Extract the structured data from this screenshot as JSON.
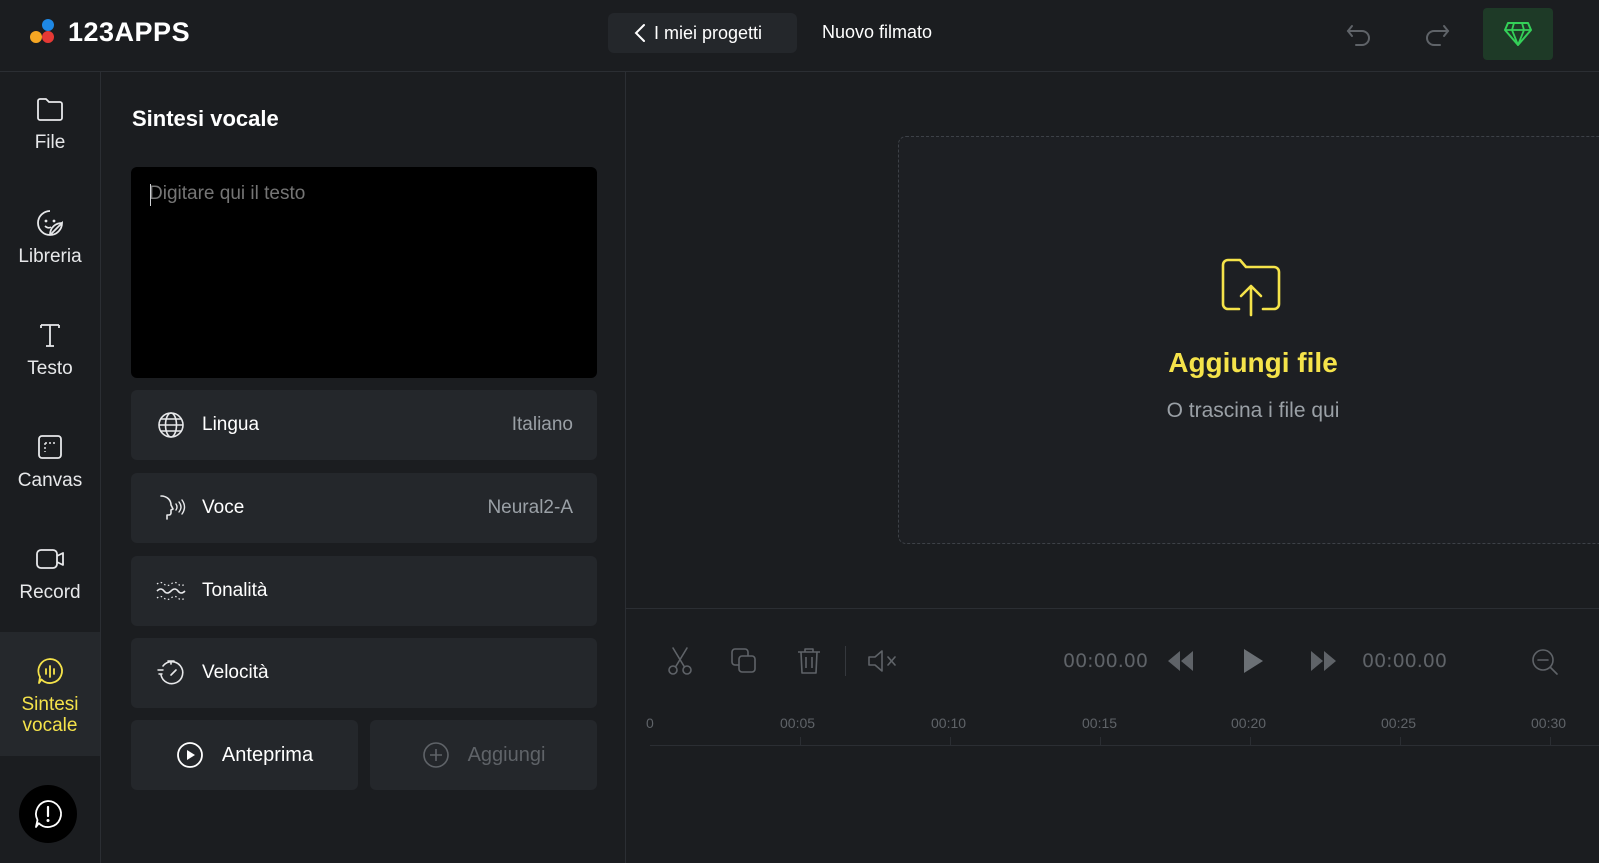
{
  "header": {
    "logo_text": "123APPS",
    "logo_colors": [
      "#f5a623",
      "#e53935",
      "#1e88e5"
    ],
    "back_label": "I miei progetti",
    "project_title": "Nuovo filmato"
  },
  "nav": {
    "items": [
      {
        "label": "File",
        "icon": "folder-icon"
      },
      {
        "label": "Libreria",
        "icon": "sticker-icon"
      },
      {
        "label": "Testo",
        "icon": "text-icon"
      },
      {
        "label": "Canvas",
        "icon": "canvas-icon"
      },
      {
        "label": "Record",
        "icon": "camera-icon"
      },
      {
        "label_line1": "Sintesi",
        "label_line2": "vocale",
        "icon": "voice-icon",
        "active": true
      }
    ]
  },
  "panel": {
    "title": "Sintesi vocale",
    "textarea_placeholder": "Digitare qui il testo",
    "options": [
      {
        "label": "Lingua",
        "value": "Italiano",
        "icon": "globe-icon"
      },
      {
        "label": "Voce",
        "value": "Neural2-A",
        "icon": "voice-speaking-icon"
      },
      {
        "label": "Tonalità",
        "value": "",
        "icon": "waves-icon"
      },
      {
        "label": "Velocità",
        "value": "",
        "icon": "timer-icon"
      }
    ],
    "preview_label": "Anteprima",
    "add_label": "Aggiungi"
  },
  "drop": {
    "title": "Aggiungi file",
    "subtitle": "O trascina i file qui"
  },
  "timeline": {
    "current_time": "00:00.00",
    "total_time": "00:00.00",
    "ticks": [
      "0",
      "00:05",
      "00:10",
      "00:15",
      "00:20",
      "00:25",
      "00:30"
    ]
  },
  "colors": {
    "accent_yellow": "#f5e34a",
    "premium_green": "#34d058"
  }
}
